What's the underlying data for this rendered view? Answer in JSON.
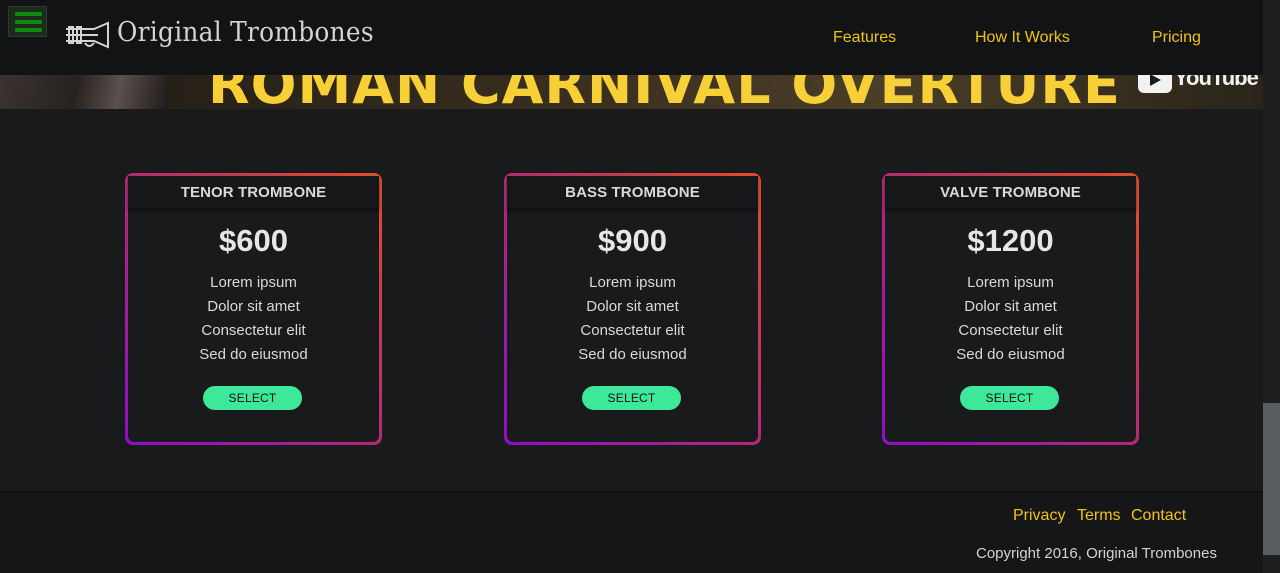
{
  "header": {
    "brand": "Original Trombones",
    "nav": [
      {
        "label": "Features"
      },
      {
        "label": "How It Works"
      },
      {
        "label": "Pricing"
      }
    ]
  },
  "banner": {
    "title": "ROMAN CARNIVAL OVERTURE",
    "youtube_label": "YouTube"
  },
  "cards": [
    {
      "title": "TENOR TROMBONE",
      "price": "$600",
      "features": [
        "Lorem ipsum",
        "Dolor sit amet",
        "Consectetur elit",
        "Sed do eiusmod"
      ],
      "button": "SELECT"
    },
    {
      "title": "BASS TROMBONE",
      "price": "$900",
      "features": [
        "Lorem ipsum",
        "Dolor sit amet",
        "Consectetur elit",
        "Sed do eiusmod"
      ],
      "button": "SELECT"
    },
    {
      "title": "VALVE TROMBONE",
      "price": "$1200",
      "features": [
        "Lorem ipsum",
        "Dolor sit amet",
        "Consectetur elit",
        "Sed do eiusmod"
      ],
      "button": "SELECT"
    }
  ],
  "footer": {
    "links": [
      {
        "label": "Privacy"
      },
      {
        "label": "Terms"
      },
      {
        "label": "Contact"
      }
    ],
    "copyright": "Copyright 2016, Original Trombones"
  },
  "colors": {
    "accent": "#f1c40f",
    "button": "#3ee89a",
    "card_border_start": "#8b10c8",
    "card_border_end": "#e0502a",
    "background": "#181a1b"
  }
}
